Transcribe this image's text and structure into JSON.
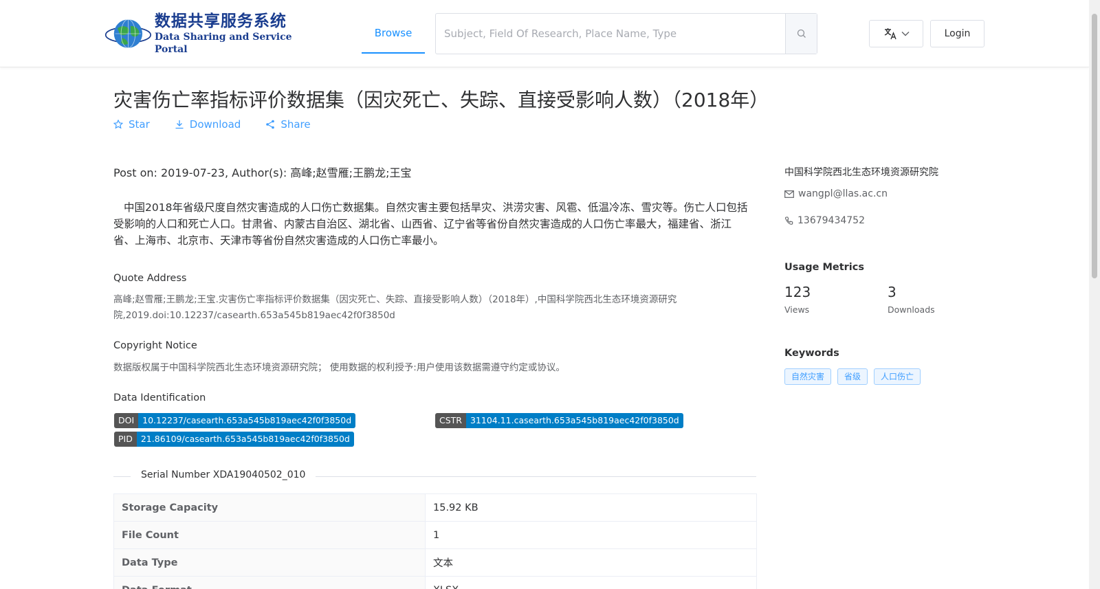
{
  "header": {
    "logo_cn": "数据共享服务系统",
    "logo_en": "Data Sharing and Service Portal",
    "logo_icon": "globe-logo",
    "nav_browse": "Browse",
    "search_placeholder": "Subject, Field Of Research, Place Name, Type",
    "search_icon": "search-icon",
    "lang_icon": "translate-icon",
    "login_label": "Login"
  },
  "dataset": {
    "title": "灾害伤亡率指标评价数据集（因灾死亡、失踪、直接受影响人数）（2018年）",
    "actions": {
      "star": "Star",
      "download": "Download",
      "share": "Share"
    },
    "post_on": "Post on: 2019-07-23, Author(s): 高峰;赵雪雁;王鹏龙;王宝",
    "abstract": "中国2018年省级尺度自然灾害造成的人口伤亡数据集。自然灾害主要包括旱灾、洪涝灾害、风雹、低温冷冻、雪灾等。伤亡人口包括受影响的人口和死亡人口。甘肃省、内蒙古自治区、湖北省、山西省、辽宁省等省份自然灾害造成的人口伤亡率最大，福建省、浙江省、上海市、北京市、天津市等省份自然灾害造成的人口伤亡率最小。",
    "quote_title": "Quote Address",
    "quote_text": "高峰;赵雪雁;王鹏龙;王宝.灾害伤亡率指标评价数据集（因灾死亡、失踪、直接受影响人数）（2018年）,中国科学院西北生态环境资源研究院,2019.doi:10.12237/casearth.653a545b819aec42f0f3850d",
    "copyright_title": "Copyright Notice",
    "copyright_text": "数据版权属于中国科学院西北生态环境资源研究院； 使用数据的权利授予:用户使用该数据需遵守约定或协议。",
    "identification_title": "Data Identification",
    "identifiers": {
      "doi_key": "DOI",
      "doi_value": "10.12237/casearth.653a545b819aec42f0f3850d",
      "cstr_key": "CSTR",
      "cstr_value": "31104.11.casearth.653a545b819aec42f0f3850d",
      "pid_key": "PID",
      "pid_value": "21.86109/casearth.653a545b819aec42f0f3850d"
    },
    "serial_number": "Serial Number XDA19040502_010",
    "specs": [
      {
        "key": "Storage Capacity",
        "value": "15.92 KB"
      },
      {
        "key": "File Count",
        "value": "1"
      },
      {
        "key": "Data Type",
        "value": "文本"
      },
      {
        "key": "Data Format",
        "value": "XLSX"
      }
    ]
  },
  "sidebar": {
    "organization": "中国科学院西北生态环境资源研究院",
    "email": "wangpl@llas.ac.cn",
    "phone": "13679434752",
    "usage_title": "Usage Metrics",
    "views_count": "123",
    "views_label": "Views",
    "downloads_count": "3",
    "downloads_label": "Downloads",
    "keywords_title": "Keywords",
    "keywords": [
      "自然灾害",
      "省级",
      "人口伤亡"
    ]
  },
  "colors": {
    "primary": "#409eff",
    "badge_key": "#555555",
    "badge_value": "#007ec6",
    "logo_blue": "#1a3d8f"
  }
}
